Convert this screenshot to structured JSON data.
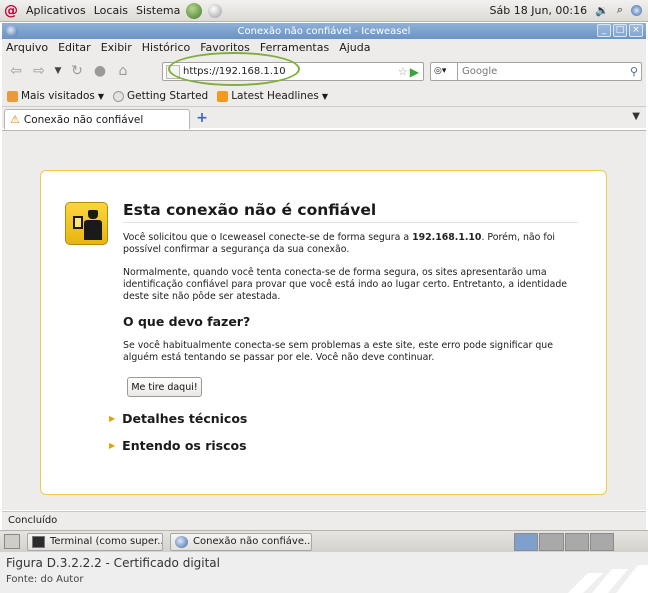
{
  "top_panel": {
    "menus": [
      "Aplicativos",
      "Locais",
      "Sistema"
    ],
    "clock": "Sáb 18 Jun, 00:16"
  },
  "window": {
    "title": "Conexão não confiável - Iceweasel"
  },
  "menubar": [
    "Arquivo",
    "Editar",
    "Exibir",
    "Histórico",
    "Favoritos",
    "Ferramentas",
    "Ajuda"
  ],
  "navbar": {
    "url": "https://192.168.1.10",
    "search_placeholder": "Google"
  },
  "bookmarks": [
    "Mais visitados",
    "Getting Started",
    "Latest Headlines"
  ],
  "tab": {
    "label": "Conexão não confiável"
  },
  "error_page": {
    "title": "Esta conexão não é confiável",
    "para1_pre": "Você solicitou que o Iceweasel conecte-se de forma segura a ",
    "para1_host": "192.168.1.10",
    "para1_post": ". Porém, não foi possível confirmar a segurança da sua conexão.",
    "para2": "Normalmente, quando você tenta conecta-se de forma segura, os sites apresentarão uma identificação confiável para provar que você está indo ao lugar certo. Entretanto, a identidade deste site não pôde ser atestada.",
    "section_title": "O que devo fazer?",
    "para3": "Se você habitualmente conecta-se sem problemas a este site, este erro pode significar que alguém está tentando se passar por ele. Você não deve continuar.",
    "button": "Me tire daqui!",
    "expander1": "Detalhes técnicos",
    "expander2": "Entendo os riscos"
  },
  "status": "Concluído",
  "taskbar": {
    "task1": "Terminal (como super...",
    "task2": "Conexão não confiáve..."
  },
  "caption": {
    "title": "Figura D.3.2.2.2 - Certificado digital",
    "source": "Fonte: do Autor"
  },
  "colors": {
    "accent_blue": "#6b93c4",
    "panel_border": "#f2c94c",
    "highlight": "#7fae3a"
  }
}
